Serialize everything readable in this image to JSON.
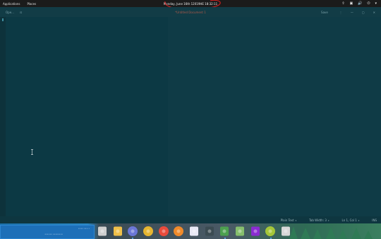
{
  "top_panel": {
    "applications": "Applications",
    "places": "Places",
    "clock": "Monday, June 16th 12019HE 18:32:11",
    "tray": [
      "⇧",
      "▣",
      "🔊",
      "⏻",
      "▾"
    ]
  },
  "editor": {
    "open_label": "Ope...",
    "title": "*Untitled Document 1",
    "save_label": "Save",
    "menu_glyph": "⋮",
    "minimize_glyph": "—",
    "maximize_glyph": "▢",
    "close_glyph": "✕"
  },
  "statusbar": {
    "syntax": "Plain Text",
    "tab_width": "Tab Width: 3",
    "cursor": "Ln 1, Col 1",
    "mode": "INS",
    "caret": "▾"
  },
  "desktop_preview": {
    "line1": "•••• ••• •",
    "line2": "•••••• ••••••••"
  },
  "dock": [
    {
      "name": "files",
      "color": "#cfcfcf",
      "running": false
    },
    {
      "name": "mail",
      "color": "#f0c04a",
      "running": false
    },
    {
      "name": "discord",
      "color": "#6b77d6",
      "running": true
    },
    {
      "name": "lollypop",
      "color": "#e6b531",
      "running": false
    },
    {
      "name": "chrome",
      "color": "#e84b3c",
      "running": false
    },
    {
      "name": "firefox",
      "color": "#f08a2a",
      "running": false
    },
    {
      "name": "libreoffice-writer",
      "color": "#e8e8f5",
      "running": false
    },
    {
      "name": "terminal",
      "color": "#3b4b52",
      "running": false
    },
    {
      "name": "text-editor",
      "color": "#4da04f",
      "running": true
    },
    {
      "name": "android-studio",
      "color": "#86bf6d",
      "running": false
    },
    {
      "name": "intellij",
      "color": "#8a2bd1",
      "running": false
    },
    {
      "name": "android",
      "color": "#a4c639",
      "running": true
    },
    {
      "name": "trash",
      "color": "#d8d8d8",
      "running": false
    }
  ]
}
